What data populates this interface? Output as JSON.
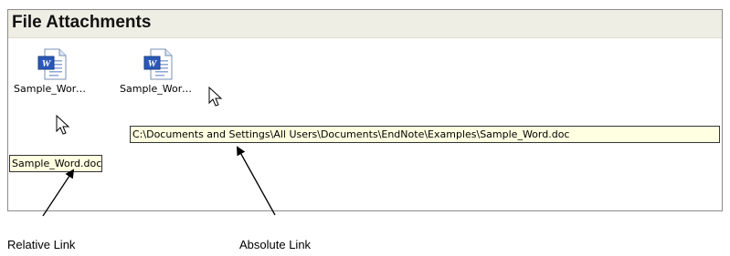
{
  "panel": {
    "title": "File Attachments"
  },
  "attachments": [
    {
      "label": "Sample_Word.doc",
      "icon": "word-document-icon"
    },
    {
      "label": "Sample_Word.doc",
      "icon": "word-document-icon"
    }
  ],
  "tooltips": {
    "relative": "Sample_Word.doc",
    "absolute": "C:\\Documents and Settings\\All Users\\Documents\\EndNote\\Examples\\Sample_Word.doc"
  },
  "annotations": {
    "relative_link": "Relative Link",
    "absolute_link": "Absolute Link"
  },
  "colors": {
    "header_bg": "#efeee5",
    "tooltip_bg": "#ffffe1",
    "word_blue": "#2b58b8"
  }
}
